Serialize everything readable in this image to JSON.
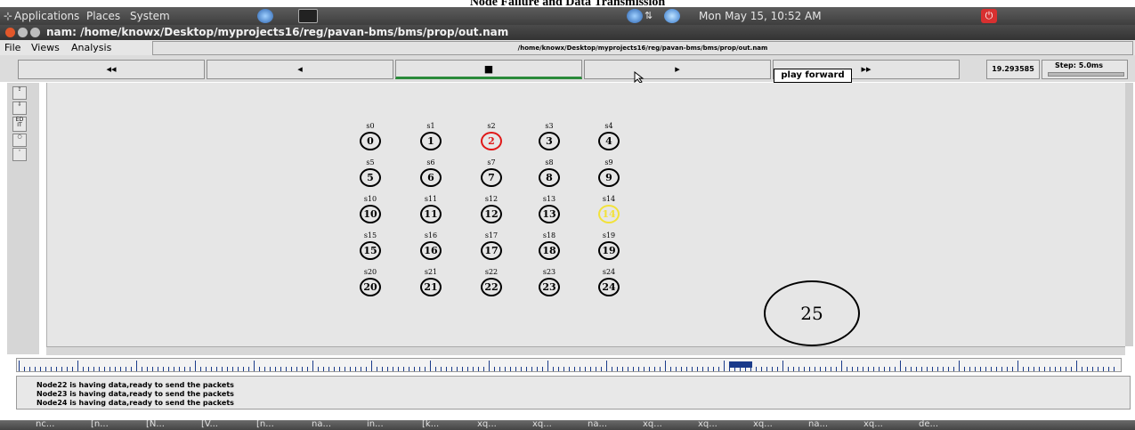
{
  "caption": "Node Failure and Data Transmission",
  "top_panel": {
    "menu": [
      "Applications",
      "Places",
      "System"
    ],
    "clock": "Mon May 15, 10:52 AM"
  },
  "window": {
    "title": "nam: /home/knowx/Desktop/myprojects16/reg/pavan-bms/bms/prop/out.nam"
  },
  "menubar": {
    "items": [
      "File",
      "Views",
      "Analysis"
    ],
    "path": "/home/knowx/Desktop/myprojects16/reg/pavan-bms/bms/prop/out.nam"
  },
  "controls": {
    "rewind": "◂◂",
    "back": "◂",
    "stop": "■",
    "play": "▸",
    "fastforward": "▸▸",
    "tooltip": "play forward",
    "time": "19.293585",
    "step": "Step: 5.0ms"
  },
  "tools": [
    "⇪",
    "⇩",
    "ED IT",
    "○",
    "◦"
  ],
  "nodes": [
    {
      "label": "s0",
      "id": "0"
    },
    {
      "label": "s1",
      "id": "1"
    },
    {
      "label": "s2",
      "id": "2",
      "state": "red"
    },
    {
      "label": "s3",
      "id": "3"
    },
    {
      "label": "s4",
      "id": "4"
    },
    {
      "label": "s5",
      "id": "5"
    },
    {
      "label": "s6",
      "id": "6"
    },
    {
      "label": "s7",
      "id": "7"
    },
    {
      "label": "s8",
      "id": "8"
    },
    {
      "label": "s9",
      "id": "9"
    },
    {
      "label": "s10",
      "id": "10"
    },
    {
      "label": "s11",
      "id": "11"
    },
    {
      "label": "s12",
      "id": "12"
    },
    {
      "label": "s13",
      "id": "13"
    },
    {
      "label": "s14",
      "id": "14",
      "state": "yellow"
    },
    {
      "label": "s15",
      "id": "15"
    },
    {
      "label": "s16",
      "id": "16"
    },
    {
      "label": "s17",
      "id": "17"
    },
    {
      "label": "s18",
      "id": "18"
    },
    {
      "label": "s19",
      "id": "19"
    },
    {
      "label": "s20",
      "id": "20"
    },
    {
      "label": "s21",
      "id": "21"
    },
    {
      "label": "s22",
      "id": "22"
    },
    {
      "label": "s23",
      "id": "23"
    },
    {
      "label": "s24",
      "id": "24"
    }
  ],
  "sink_node": "25",
  "log": [
    "Node22 is having data,ready to send the packets",
    "Node23 is having data,ready to send the packets",
    "Node24 is having data,ready to send the packets"
  ],
  "taskbar": [
    "nc...",
    "[n...",
    "[N...",
    "[V...",
    "[n...",
    "na...",
    "in...",
    "[k...",
    "xq...",
    "xq...",
    "na...",
    "xq...",
    "xq...",
    "xq...",
    "na...",
    "xq...",
    "de..."
  ],
  "colors": {
    "failed_node": "#e01818",
    "active_node": "#f2e23a",
    "timeline": "#1a3b8a"
  }
}
